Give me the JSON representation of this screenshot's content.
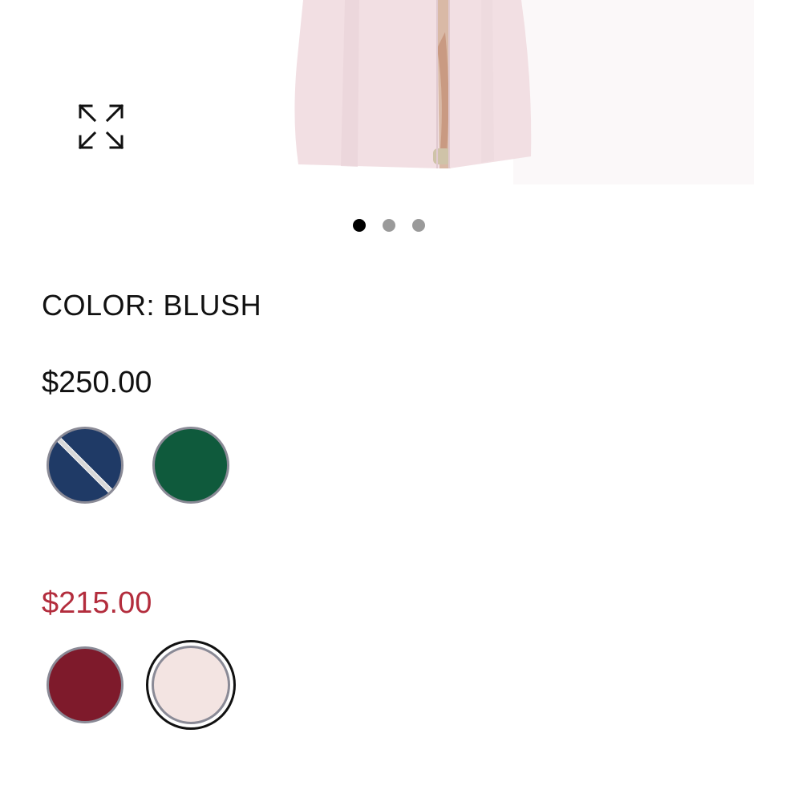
{
  "carousel": {
    "total_slides": 3,
    "active_index": 0
  },
  "icons": {
    "expand": "expand-arrows-icon"
  },
  "product": {
    "color_label": "COLOR: BLUSH",
    "selected_color": "Blush"
  },
  "price_groups": [
    {
      "price": "$250.00",
      "price_color": "#111111",
      "swatches": [
        {
          "color": "#1f3a66",
          "unavailable": true,
          "selected": false
        },
        {
          "color": "#0f5a3c",
          "unavailable": false,
          "selected": false
        }
      ]
    },
    {
      "price": "$215.00",
      "price_color": "#b32d3d",
      "swatches": [
        {
          "color": "#7e1a2b",
          "unavailable": false,
          "selected": false
        },
        {
          "color": "#f3e4e2",
          "unavailable": false,
          "selected": true
        }
      ]
    }
  ],
  "colors": {
    "dress_fill": "#f2dfe3",
    "sale_price": "#b32d3d",
    "active_dot": "#000000",
    "inactive_dot": "#9a9a9a"
  }
}
